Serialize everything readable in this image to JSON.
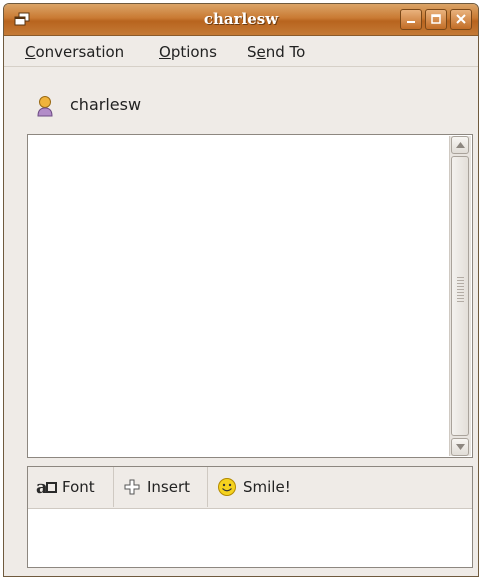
{
  "window": {
    "title": "charlesw",
    "controls": [
      "minimize",
      "maximize",
      "close"
    ]
  },
  "menubar": {
    "items": [
      {
        "label": "Conversation",
        "mnemonic_index": 0
      },
      {
        "label": "Options",
        "mnemonic_index": 0
      },
      {
        "label": "Send To",
        "mnemonic_index": 1
      }
    ]
  },
  "buddy": {
    "name": "charlesw",
    "icon": "person-icon"
  },
  "toolbar": {
    "font_label": "Font",
    "insert_label": "Insert",
    "smile_label": "Smile!"
  },
  "compose": {
    "value": ""
  },
  "colors": {
    "titlebar": "#c97a33",
    "window_bg": "#efebe7",
    "text": "#222222"
  }
}
